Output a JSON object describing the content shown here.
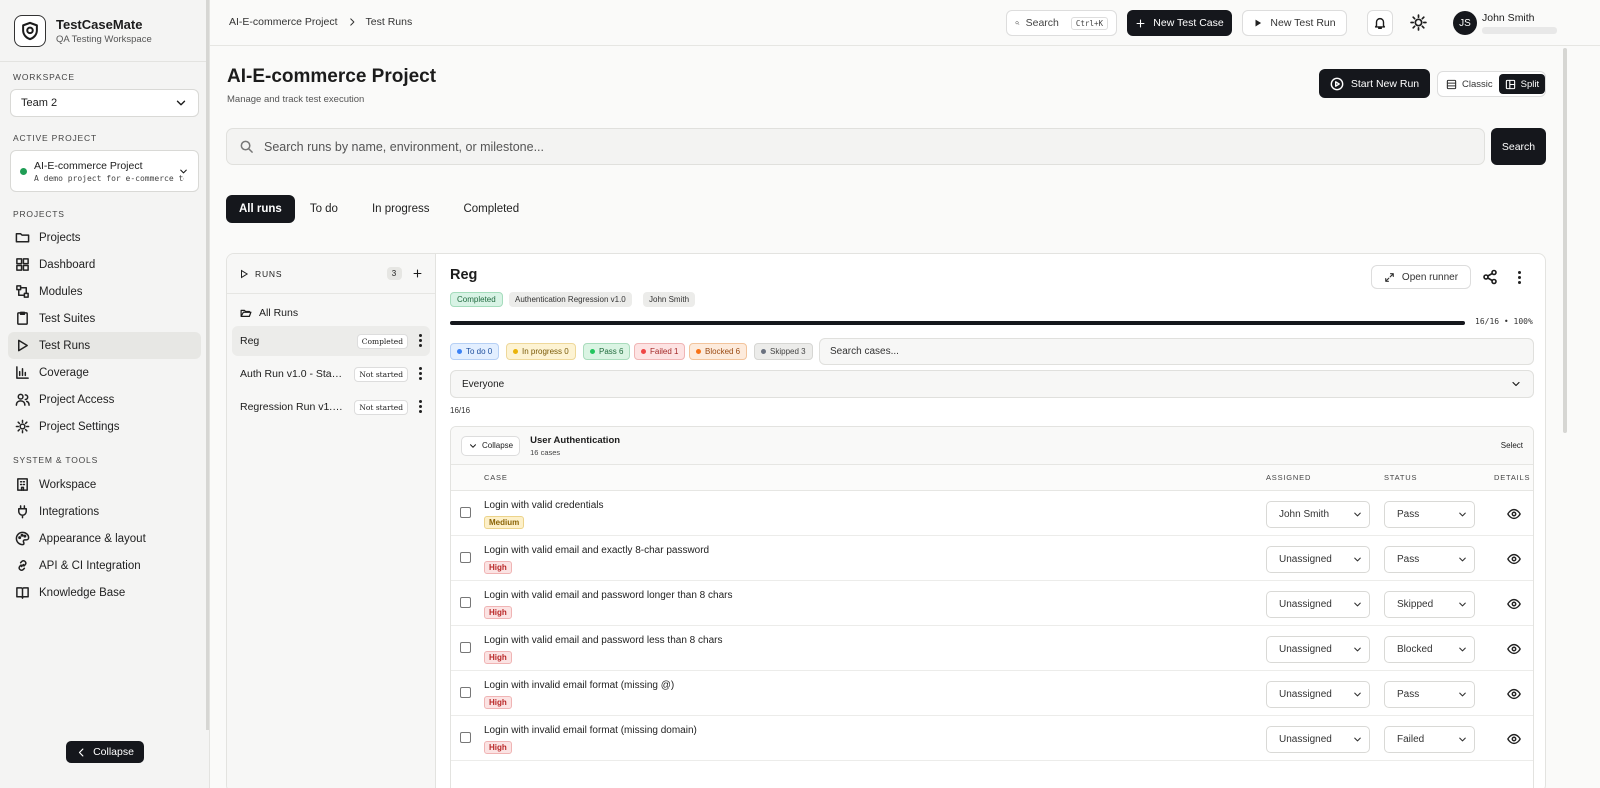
{
  "brand": {
    "name": "TestCaseMate",
    "subtitle": "QA Testing Workspace"
  },
  "sidebar": {
    "workspace_label": "WORKSPACE",
    "workspace_value": "Team 2",
    "active_project_label": "ACTIVE PROJECT",
    "project_name": "AI-E-commerce Project",
    "project_desc": "A demo project for e-commerce testi…",
    "projects_label": "PROJECTS",
    "items": [
      {
        "label": "Projects",
        "icon": "folder-icon"
      },
      {
        "label": "Dashboard",
        "icon": "dashboard-icon"
      },
      {
        "label": "Modules",
        "icon": "modules-icon"
      },
      {
        "label": "Test Suites",
        "icon": "suites-icon"
      },
      {
        "label": "Test Runs",
        "icon": "play-icon"
      },
      {
        "label": "Coverage",
        "icon": "chart-icon"
      },
      {
        "label": "Project Access",
        "icon": "users-icon"
      },
      {
        "label": "Project Settings",
        "icon": "gear-icon"
      }
    ],
    "system_label": "SYSTEM & TOOLS",
    "system_items": [
      {
        "label": "Workspace",
        "icon": "building-icon"
      },
      {
        "label": "Integrations",
        "icon": "plug-icon"
      },
      {
        "label": "Appearance & layout",
        "icon": "palette-icon"
      },
      {
        "label": "API & CI Integration",
        "icon": "link-icon"
      },
      {
        "label": "Knowledge Base",
        "icon": "book-icon"
      }
    ],
    "collapse_label": "Collapse"
  },
  "topbar": {
    "breadcrumb": [
      "AI-E-commerce Project",
      "Test Runs"
    ],
    "search_label": "Search",
    "search_kbd": "Ctrl+K",
    "new_case_label": "New Test Case",
    "new_run_label": "New Test Run",
    "user_name": "John Smith",
    "user_initials": "JS"
  },
  "header": {
    "title": "AI-E-commerce Project",
    "subtitle": "Manage and track test execution",
    "start_run_label": "Start New Run",
    "view_classic": "Classic",
    "view_split": "Split"
  },
  "search": {
    "placeholder": "Search runs by name, environment, or milestone...",
    "button": "Search"
  },
  "tabs": [
    "All runs",
    "To do",
    "In progress",
    "Completed"
  ],
  "runs": {
    "header": "RUNS",
    "count": "3",
    "all_label": "All Runs",
    "items": [
      {
        "name": "Reg",
        "status": "Completed"
      },
      {
        "name": "Auth Run v1.0 - Sta…",
        "status": "Not started"
      },
      {
        "name": "Regression Run v1.…",
        "status": "Not started"
      }
    ]
  },
  "detail": {
    "title": "Reg",
    "open_runner": "Open runner",
    "chips": [
      "Completed",
      "Authentication Regression v1.0",
      "John Smith"
    ],
    "progress_fraction": 1.0,
    "progress_text": "16/16 • 100%",
    "filters": [
      {
        "label": "To do 0",
        "color": "#3b82f6"
      },
      {
        "label": "In progress 0",
        "color": "#eab308"
      },
      {
        "label": "Pass 6",
        "color": "#22c55e"
      },
      {
        "label": "Failed 1",
        "color": "#ef4444"
      },
      {
        "label": "Blocked 6",
        "color": "#f97316"
      },
      {
        "label": "Skipped 3",
        "color": "#6b7280"
      }
    ],
    "case_search_placeholder": "Search cases...",
    "assignee_filter": "Everyone",
    "count": "16/16",
    "group": {
      "collapse": "Collapse",
      "title": "User Authentication",
      "sub": "16 cases",
      "select": "Select"
    },
    "columns": {
      "case": "CASE",
      "assigned": "ASSIGNED",
      "status": "STATUS",
      "details": "DETAILS"
    },
    "rows": [
      {
        "name": "Login with valid credentials",
        "priority": "Medium",
        "assigned": "John Smith",
        "status": "Pass"
      },
      {
        "name": "Login with valid email and exactly 8-char password",
        "priority": "High",
        "assigned": "Unassigned",
        "status": "Pass"
      },
      {
        "name": "Login with valid email and password longer than 8 chars",
        "priority": "High",
        "assigned": "Unassigned",
        "status": "Skipped"
      },
      {
        "name": "Login with valid email and password less than 8 chars",
        "priority": "High",
        "assigned": "Unassigned",
        "status": "Blocked"
      },
      {
        "name": "Login with invalid email format (missing @)",
        "priority": "High",
        "assigned": "Unassigned",
        "status": "Pass"
      },
      {
        "name": "Login with invalid email format (missing domain)",
        "priority": "High",
        "assigned": "Unassigned",
        "status": "Failed"
      }
    ]
  }
}
